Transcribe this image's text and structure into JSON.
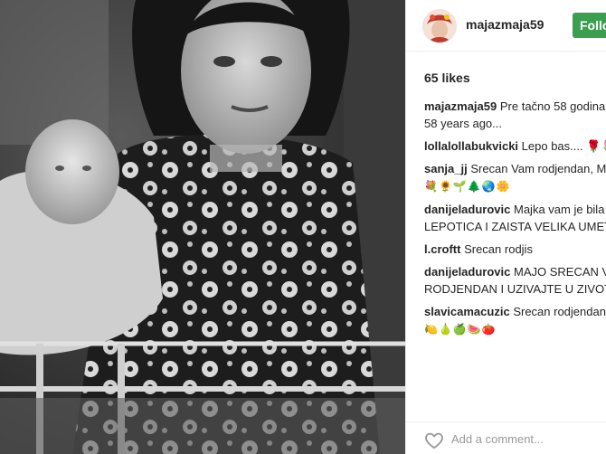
{
  "post": {
    "username": "majazmaja59",
    "follow_label": "Follo",
    "likes": "65 likes",
    "add_comment_placeholder": "Add a comment..."
  },
  "comments": [
    {
      "user": "majazmaja59",
      "text": "Pre tačno 58 godina.",
      "text2": "58 years ago..."
    },
    {
      "user": "lollalollabukvicki",
      "text": "Lepo bas.... 🌹🌷🌹"
    },
    {
      "user": "sanja_jj",
      "text": "Srecan Vam rodjendan, Ma",
      "text2": "💐🌻🌱🌲🌏🌼"
    },
    {
      "user": "danijeladurovic",
      "text": "Majka vam je bila P",
      "text2": "LEPOTICA I ZAISTA VELIKA UMETN"
    },
    {
      "user": "l.croftt",
      "text": "Srecan rodjis"
    },
    {
      "user": "danijeladurovic",
      "text": "MAJO SRECAN VA",
      "text2": "RODJENDAN I UZIVAJTE U ZIVOTU"
    },
    {
      "user": "slavicamacuzic",
      "text": "Srecan rodjendan 🌷",
      "text2": "🍋🍐🍏🍉🍅"
    }
  ],
  "icons": {
    "heart": "heart-icon",
    "avatar": "avatar"
  }
}
